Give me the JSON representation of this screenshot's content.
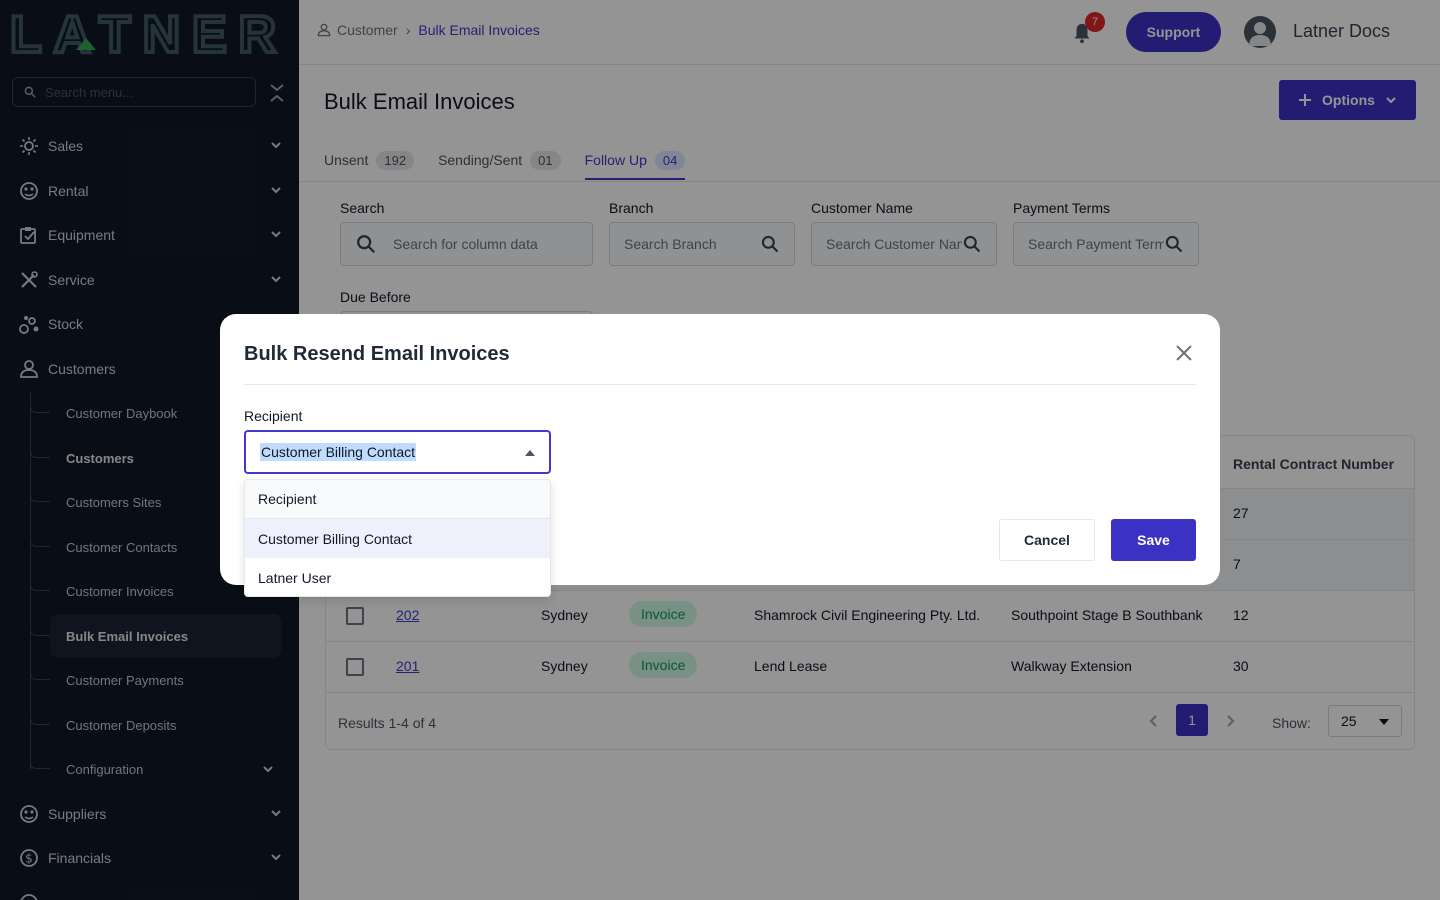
{
  "brand": {
    "name": "LATNER"
  },
  "sidebar": {
    "search_placeholder": "Search menu...",
    "items": [
      {
        "label": "Sales",
        "icon": "sales-icon"
      },
      {
        "label": "Rental",
        "icon": "rental-icon"
      },
      {
        "label": "Equipment",
        "icon": "equipment-icon"
      },
      {
        "label": "Service",
        "icon": "tools-icon"
      },
      {
        "label": "Stock",
        "icon": "stock-icon"
      },
      {
        "label": "Customers",
        "icon": "user-icon"
      },
      {
        "label": "Suppliers",
        "icon": "suppliers-icon"
      },
      {
        "label": "Financials",
        "icon": "dollar-icon"
      }
    ],
    "customer_sub": [
      "Customer Daybook",
      "Customers",
      "Customers Sites",
      "Customer Contacts",
      "Customer Invoices",
      "Bulk Email Invoices",
      "Customer Payments",
      "Customer Deposits",
      "Configuration"
    ]
  },
  "topbar": {
    "breadcrumb": [
      "Customer",
      "Bulk Email Invoices"
    ],
    "notification_count": "7",
    "support_label": "Support",
    "user_name": "Latner Docs"
  },
  "page": {
    "title": "Bulk Email Invoices",
    "options_label": "Options",
    "tabs": [
      {
        "label": "Unsent",
        "count": "192"
      },
      {
        "label": "Sending/Sent",
        "count": "01"
      },
      {
        "label": "Follow Up",
        "count": "04"
      }
    ],
    "filters": {
      "search_label": "Search",
      "search_placeholder": "Search for column data",
      "branch_label": "Branch",
      "branch_placeholder": "Search Branch",
      "customer_label": "Customer Name",
      "customer_placeholder": "Search Customer Name",
      "terms_label": "Payment Terms",
      "terms_placeholder": "Search Payment Terms",
      "due_label": "Due Before"
    }
  },
  "table": {
    "header_visible": "Rental Contract Number",
    "partial_rows": [
      "27",
      "7"
    ],
    "rows": [
      {
        "id": "202",
        "branch": "Sydney",
        "type": "Invoice",
        "customer": "Shamrock Civil Engineering Pty. Ltd.",
        "site": "Southpoint Stage B Southbank",
        "contract": "12"
      },
      {
        "id": "201",
        "branch": "Sydney",
        "type": "Invoice",
        "customer": "Lend Lease",
        "site": "Walkway Extension",
        "contract": "30"
      }
    ],
    "results_text": "Results 1-4 of 4",
    "current_page": "1",
    "show_label": "Show:",
    "show_value": "25"
  },
  "modal": {
    "title": "Bulk Resend Email Invoices",
    "recipient_label": "Recipient",
    "recipient_value": "Customer Billing Contact",
    "options": [
      "Recipient",
      "Customer Billing Contact",
      "Latner User"
    ],
    "cancel_label": "Cancel",
    "save_label": "Save"
  },
  "colors": {
    "sidebar_bg": "#111827",
    "accent": "#3b32c4",
    "status_green": "#059669",
    "badge_red": "#dc2626"
  }
}
